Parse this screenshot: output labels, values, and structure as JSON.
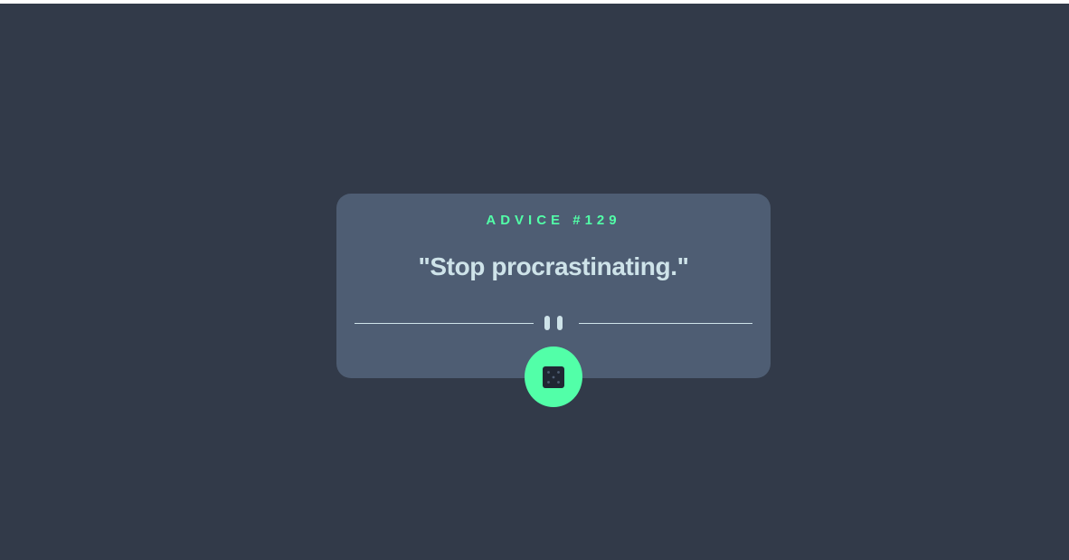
{
  "advice": {
    "id_label": "ADVICE #129",
    "quote": "\"Stop procrastinating.\""
  },
  "divider": {
    "icon": "pause-icon"
  },
  "dice_button": {
    "icon": "dice-icon"
  },
  "colors": {
    "background": "#323a49",
    "card": "#4e5d73",
    "accent": "#52ffa8",
    "text": "#cee3e9"
  }
}
